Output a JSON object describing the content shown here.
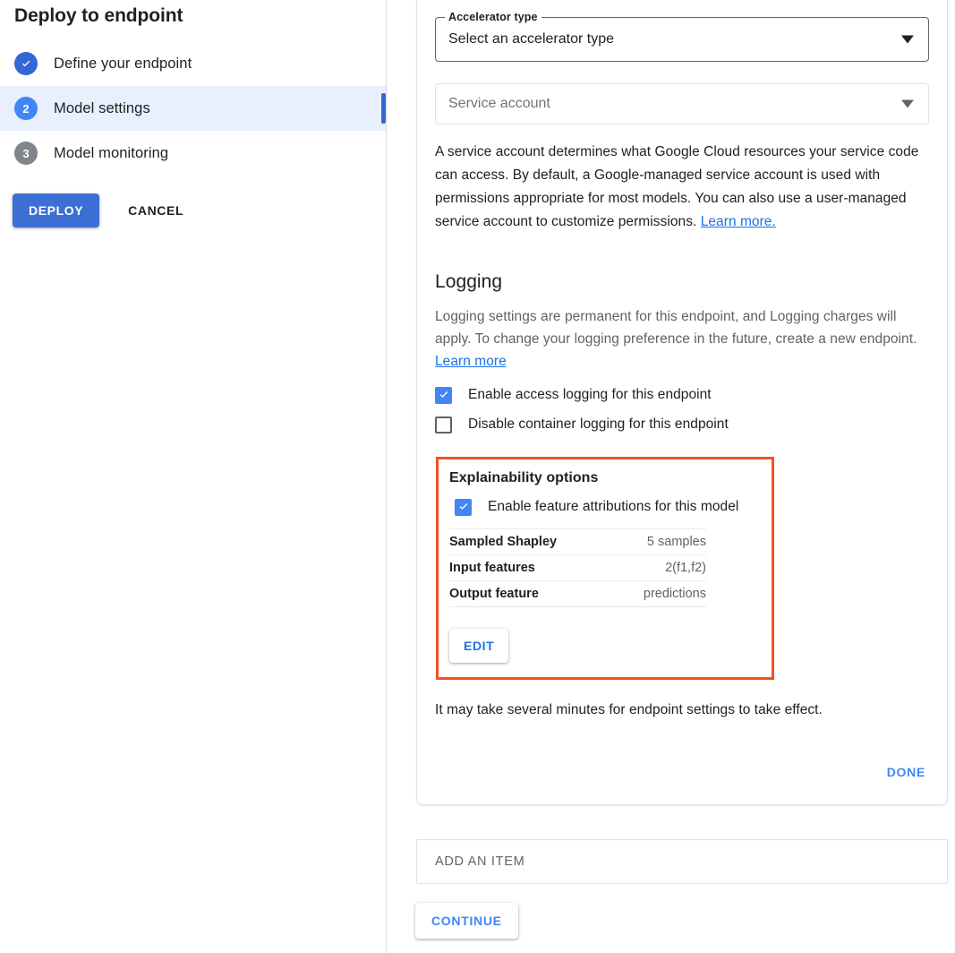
{
  "wizard": {
    "title": "Deploy to endpoint",
    "steps": [
      {
        "badge": "check-icon",
        "number": "1",
        "label": "Define your endpoint",
        "state": "done"
      },
      {
        "badge": "2",
        "number": "2",
        "label": "Model settings",
        "state": "current"
      },
      {
        "badge": "3",
        "number": "3",
        "label": "Model monitoring",
        "state": "todo"
      }
    ],
    "deploy_label": "DEPLOY",
    "cancel_label": "CANCEL"
  },
  "form": {
    "accelerator": {
      "legend": "Accelerator type",
      "value": "Select an accelerator type"
    },
    "service_account": {
      "placeholder": "Service account"
    },
    "service_account_help": {
      "text": " A service account determines what Google Cloud resources your service code can access. By default, a Google-managed service account is used with permissions appropriate for most models. You can also use a user-managed service account to customize permissions. ",
      "link": "Learn more."
    }
  },
  "logging": {
    "heading": "Logging",
    "description": "Logging settings are permanent for this endpoint, and Logging charges will apply. To change your logging preference in the future, create a new endpoint. ",
    "link": "Learn more",
    "options": [
      {
        "label": "Enable access logging for this endpoint",
        "checked": true
      },
      {
        "label": "Disable container logging for this endpoint",
        "checked": false
      }
    ]
  },
  "explainability": {
    "title": "Explainability options",
    "checkbox_label": "Enable feature attributions for this model",
    "checked": true,
    "rows": [
      {
        "key": "Sampled Shapley",
        "value": "5 samples"
      },
      {
        "key": "Input features",
        "value": "2(f1,f2)"
      },
      {
        "key": "Output feature",
        "value": "predictions"
      }
    ],
    "edit_label": "EDIT",
    "highlight_color": "#f4511e"
  },
  "footer": {
    "effect_note": "It may take several minutes for endpoint settings to take effect.",
    "done_label": "DONE",
    "add_item_label": "ADD AN ITEM",
    "continue_label": "CONTINUE"
  },
  "colors": {
    "accent_blue": "#4285f4",
    "link_blue": "#1a73e8",
    "active_row": "#e8f0fe",
    "highlight_red": "#f4511e"
  }
}
